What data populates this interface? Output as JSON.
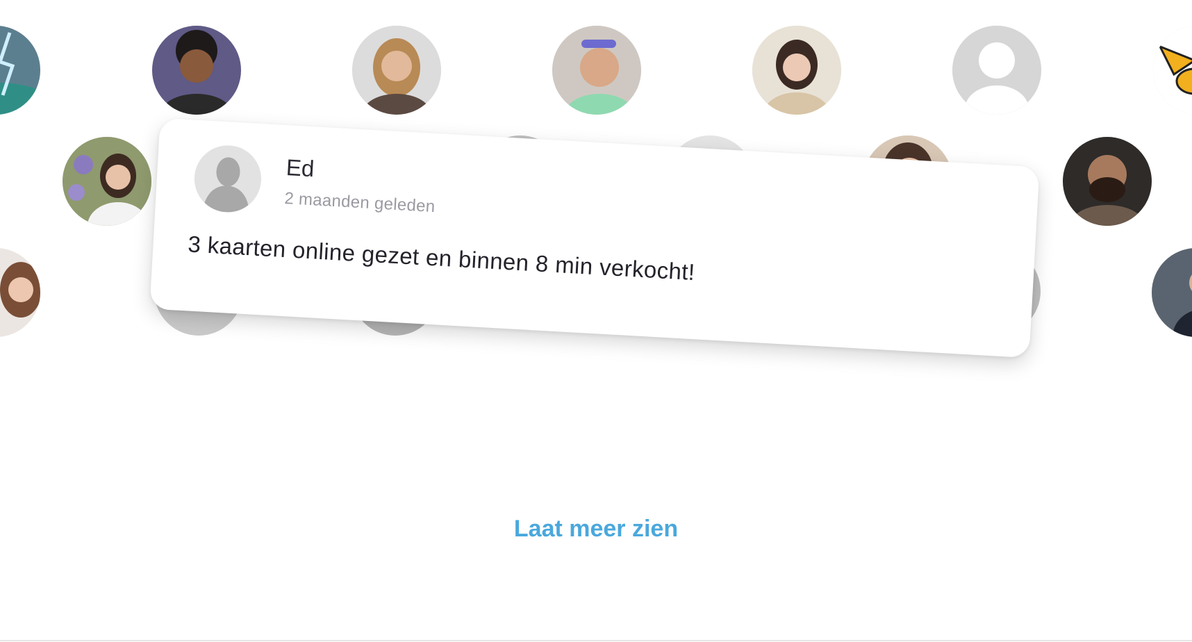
{
  "colors": {
    "link": "#4aa8dc",
    "card_bg": "#ffffff",
    "time_text": "#9a9aa2",
    "body_text": "#23232b"
  },
  "avatars": [
    {
      "name": "avatar-lightning-graphic",
      "icon": "lightning-graphic"
    },
    {
      "name": "avatar-person-curly-hair",
      "icon": "person-photo"
    },
    {
      "name": "avatar-person-blonde",
      "icon": "person-photo"
    },
    {
      "name": "avatar-person-sunglasses-on-head",
      "icon": "person-photo"
    },
    {
      "name": "avatar-person-dark-hair",
      "icon": "person-photo"
    },
    {
      "name": "avatar-default-placeholder",
      "icon": "default-user-silhouette"
    },
    {
      "name": "avatar-cartoon-bird",
      "icon": "cartoon-graphic"
    },
    {
      "name": "avatar-person-flowers",
      "icon": "person-photo"
    },
    {
      "name": "avatar-person-bearded",
      "icon": "person-photo"
    },
    {
      "name": "avatar-person-left-edge",
      "icon": "person-photo"
    },
    {
      "name": "avatar-person-suit-right-edge",
      "icon": "person-photo"
    }
  ],
  "testimonial": {
    "author_name": "Ed",
    "time_ago": "2 maanden geleden",
    "text": "3 kaarten online gezet en binnen 8 min verkocht!",
    "avatar_icon": "default-user-silhouette"
  },
  "show_more": {
    "label": "Laat meer zien"
  }
}
